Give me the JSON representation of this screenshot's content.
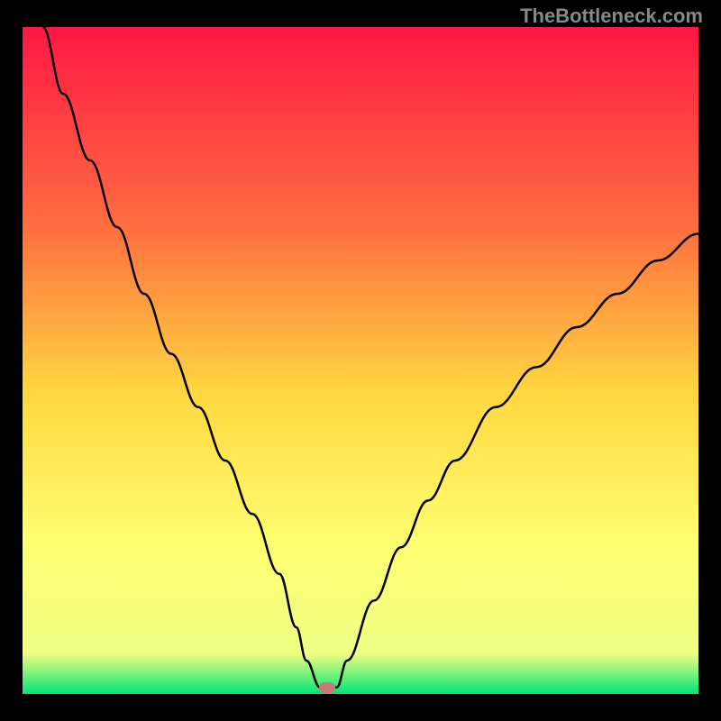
{
  "watermark": "TheBottleneck.com",
  "chart_data": {
    "type": "line",
    "title": "",
    "xlabel": "",
    "ylabel": "",
    "xlim": [
      0,
      100
    ],
    "ylim": [
      0,
      100
    ],
    "gradient_colors": {
      "top": "#ff1744",
      "upper_mid": "#ff6e40",
      "mid": "#ffd740",
      "lower_mid": "#ffff72",
      "near_bottom": "#eeff82",
      "bottom": "#00e676"
    },
    "series": [
      {
        "name": "bottleneck-curve",
        "x": [
          3,
          6,
          10,
          14,
          18,
          22,
          26,
          30,
          34,
          38,
          40.5,
          42,
          44,
          46.5,
          48,
          52,
          56,
          60,
          64,
          70,
          76,
          82,
          88,
          94,
          100
        ],
        "values": [
          100,
          90,
          80,
          70,
          60,
          51,
          43,
          35,
          27,
          18,
          10,
          5,
          1,
          1,
          5,
          14,
          22,
          29,
          35,
          43,
          49,
          55,
          60,
          65,
          69
        ]
      }
    ],
    "marker": {
      "x": 45,
      "y": 1.0,
      "color": "#c87878"
    }
  }
}
